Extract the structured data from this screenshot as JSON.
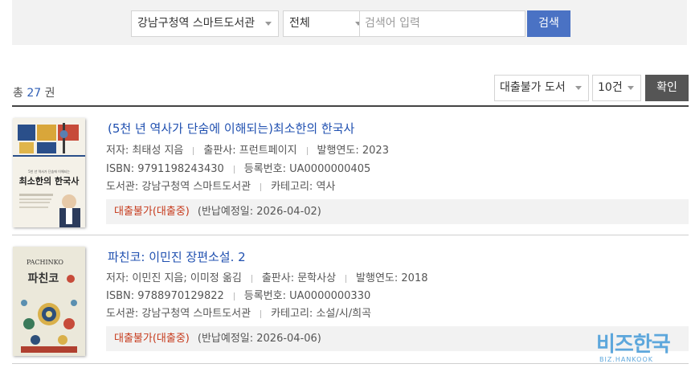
{
  "search": {
    "library_select": "강남구청역 스마트도서관",
    "scope_select": "전체",
    "placeholder": "검색어 입력",
    "button": "검색"
  },
  "results": {
    "total_prefix": "총",
    "total_count": "27",
    "total_suffix": "권",
    "filter_status": "대출불가 도서",
    "filter_count": "10건",
    "confirm_button": "확인"
  },
  "books": [
    {
      "title": "(5천 년 역사가 단숨에 이해되는)최소한의 한국사",
      "author": "저자: 최태성 지음",
      "publisher": "출판사: 프런트페이지",
      "year": "발행연도: 2023",
      "isbn": "ISBN: 9791198243430",
      "reg_no": "등록번호: UA0000000405",
      "library": "도서관: 강남구청역 스마트도서관",
      "category": "카테고리: 역사",
      "status": "대출불가(대출중)",
      "due": "(반납예정일: 2026-04-02)",
      "cover_text_1": "5천 년 역사가 단숨에 이해되는",
      "cover_text_2": "최소한의 한국사"
    },
    {
      "title": "파친코: 이민진 장편소설. 2",
      "author": "저자: 이민진 지음; 이미정 옮김",
      "publisher": "출판사: 문학사상",
      "year": "발행연도: 2018",
      "isbn": "ISBN: 9788970129822",
      "reg_no": "등록번호: UA0000000330",
      "library": "도서관: 강남구청역 스마트도서관",
      "category": "카테고리: 소설/시/희곡",
      "status": "대출불가(대출중)",
      "due": "(반납예정일: 2026-04-06)",
      "cover_text_1": "PACHINKO",
      "cover_text_2": "파친코"
    }
  ],
  "watermark": {
    "main": "비즈한국",
    "sub": "BIZ.HANKOOK"
  },
  "colors": {
    "search_button": "#4a72c4",
    "confirm_button": "#555555",
    "title_link": "#2050b0",
    "status_unavailable": "#c63a1c",
    "logo": "#5da7dc"
  }
}
